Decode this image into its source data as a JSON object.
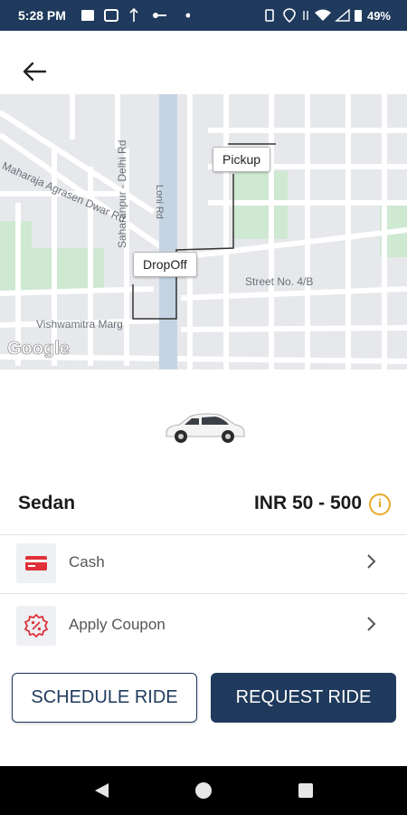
{
  "status_bar": {
    "time": "5:28 PM",
    "battery": "49%"
  },
  "map": {
    "pickup_label": "Pickup",
    "dropoff_label": "DropOff",
    "streets": {
      "maharaja": "Maharaja Agrasen Dwar Rd",
      "saharanpur": "Saharanpur - Delhi Rd",
      "loni": "Loni Rd",
      "street4b": "Street No. 4/B",
      "vishwamitra": "Vishwamitra Marg"
    },
    "attribution": "Google"
  },
  "vehicle": {
    "name": "Sedan",
    "fare": "INR 50 - 500",
    "info_symbol": "i"
  },
  "options": [
    {
      "label": "Cash",
      "icon": "credit-card-icon"
    },
    {
      "label": "Apply Coupon",
      "icon": "coupon-icon"
    }
  ],
  "actions": {
    "schedule": "SCHEDULE RIDE",
    "request": "REQUEST RIDE"
  },
  "colors": {
    "primary": "#1f3a5c",
    "accent_red": "#e0303a",
    "info_amber": "#e8a826"
  }
}
